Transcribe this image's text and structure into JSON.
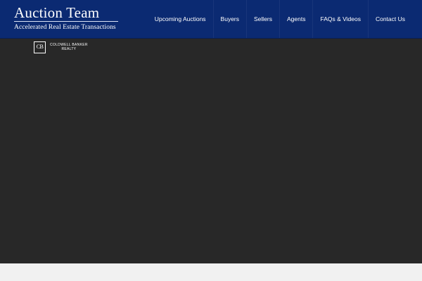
{
  "header": {
    "brand_title": "Auction Team",
    "brand_tagline": "Accelerated Real Estate Transactions",
    "background_color": "#0b2a72"
  },
  "nav": {
    "items": [
      {
        "label": "Upcoming Auctions"
      },
      {
        "label": "Buyers"
      },
      {
        "label": "Sellers"
      },
      {
        "label": "Agents"
      },
      {
        "label": "FAQs & Videos"
      },
      {
        "label": "Contact Us"
      }
    ]
  },
  "partner_logo": {
    "mark": "CB",
    "line1": "COLDWELL BANKER",
    "line2": "REALTY"
  },
  "colors": {
    "content_background": "#282828",
    "footer_background": "#f1f1f1"
  }
}
